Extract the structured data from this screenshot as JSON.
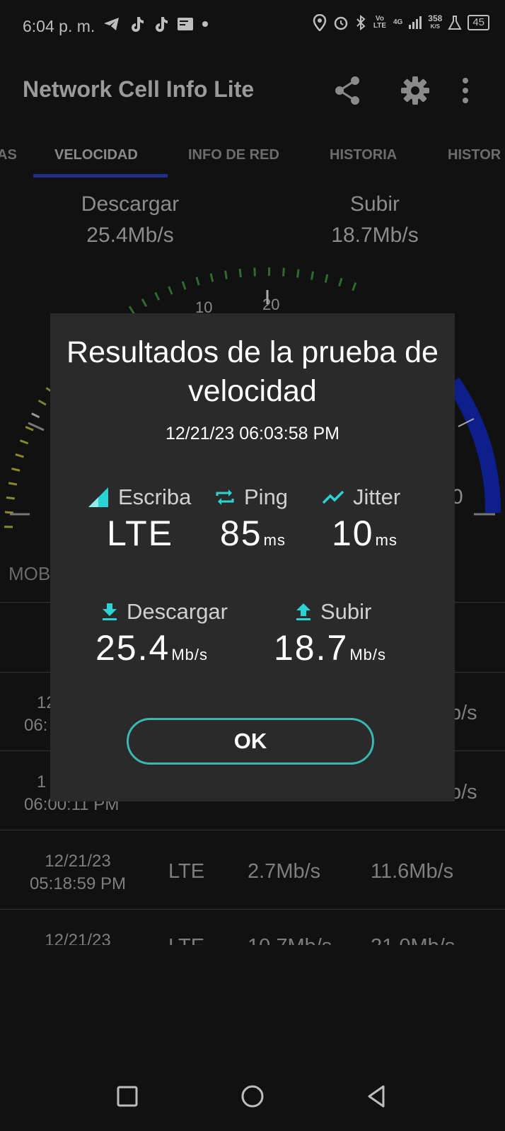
{
  "status_bar": {
    "time": "6:04 p. m.",
    "volte": "Vo LTE",
    "network": "4G",
    "speed_value": "358",
    "speed_unit": "K/S",
    "battery": "45"
  },
  "app_bar": {
    "title": "Network Cell Info Lite",
    "icons": [
      "share-icon",
      "settings-gear-icon",
      "more-vert-icon"
    ]
  },
  "tabs": [
    {
      "label": "AS"
    },
    {
      "label": "VELOCIDAD"
    },
    {
      "label": "INFO DE RED"
    },
    {
      "label": "HISTORIA"
    },
    {
      "label": "HISTOR"
    }
  ],
  "speed_summary": {
    "download_label": "Descargar",
    "download_value": "25.4Mb/s",
    "upload_label": "Subir",
    "upload_value": "18.7Mb/s"
  },
  "gauge": {
    "tick_labels": [
      "10",
      "20",
      "0"
    ]
  },
  "side_label": "MOB",
  "history": [
    {
      "date": "12/",
      "time": "06:",
      "type": "",
      "download": "",
      "upload": "b/s"
    },
    {
      "date": "1",
      "time": "06:00:11 PM",
      "type": "",
      "download": "",
      "upload": "b/s"
    },
    {
      "date": "12/21/23",
      "time": "05:18:59 PM",
      "type": "LTE",
      "download": "2.7Mb/s",
      "upload": "11.6Mb/s"
    },
    {
      "date": "12/21/23",
      "time": "",
      "type": "LTE",
      "download": "10.7Mb/s",
      "upload": "21.0Mb/s"
    }
  ],
  "dialog": {
    "title": "Resultados de la prueba de velocidad",
    "timestamp": "12/21/23 06:03:58 PM",
    "type_label": "Escriba",
    "type_value": "LTE",
    "ping_label": "Ping",
    "ping_value": "85",
    "ping_unit": "ms",
    "jitter_label": "Jitter",
    "jitter_value": "10",
    "jitter_unit": "ms",
    "download_label": "Descargar",
    "download_value": "25.4",
    "download_unit": "Mb/s",
    "upload_label": "Subir",
    "upload_value": "18.7",
    "upload_unit": "Mb/s",
    "ok_label": "OK",
    "accent_color": "#2ad4d4"
  }
}
